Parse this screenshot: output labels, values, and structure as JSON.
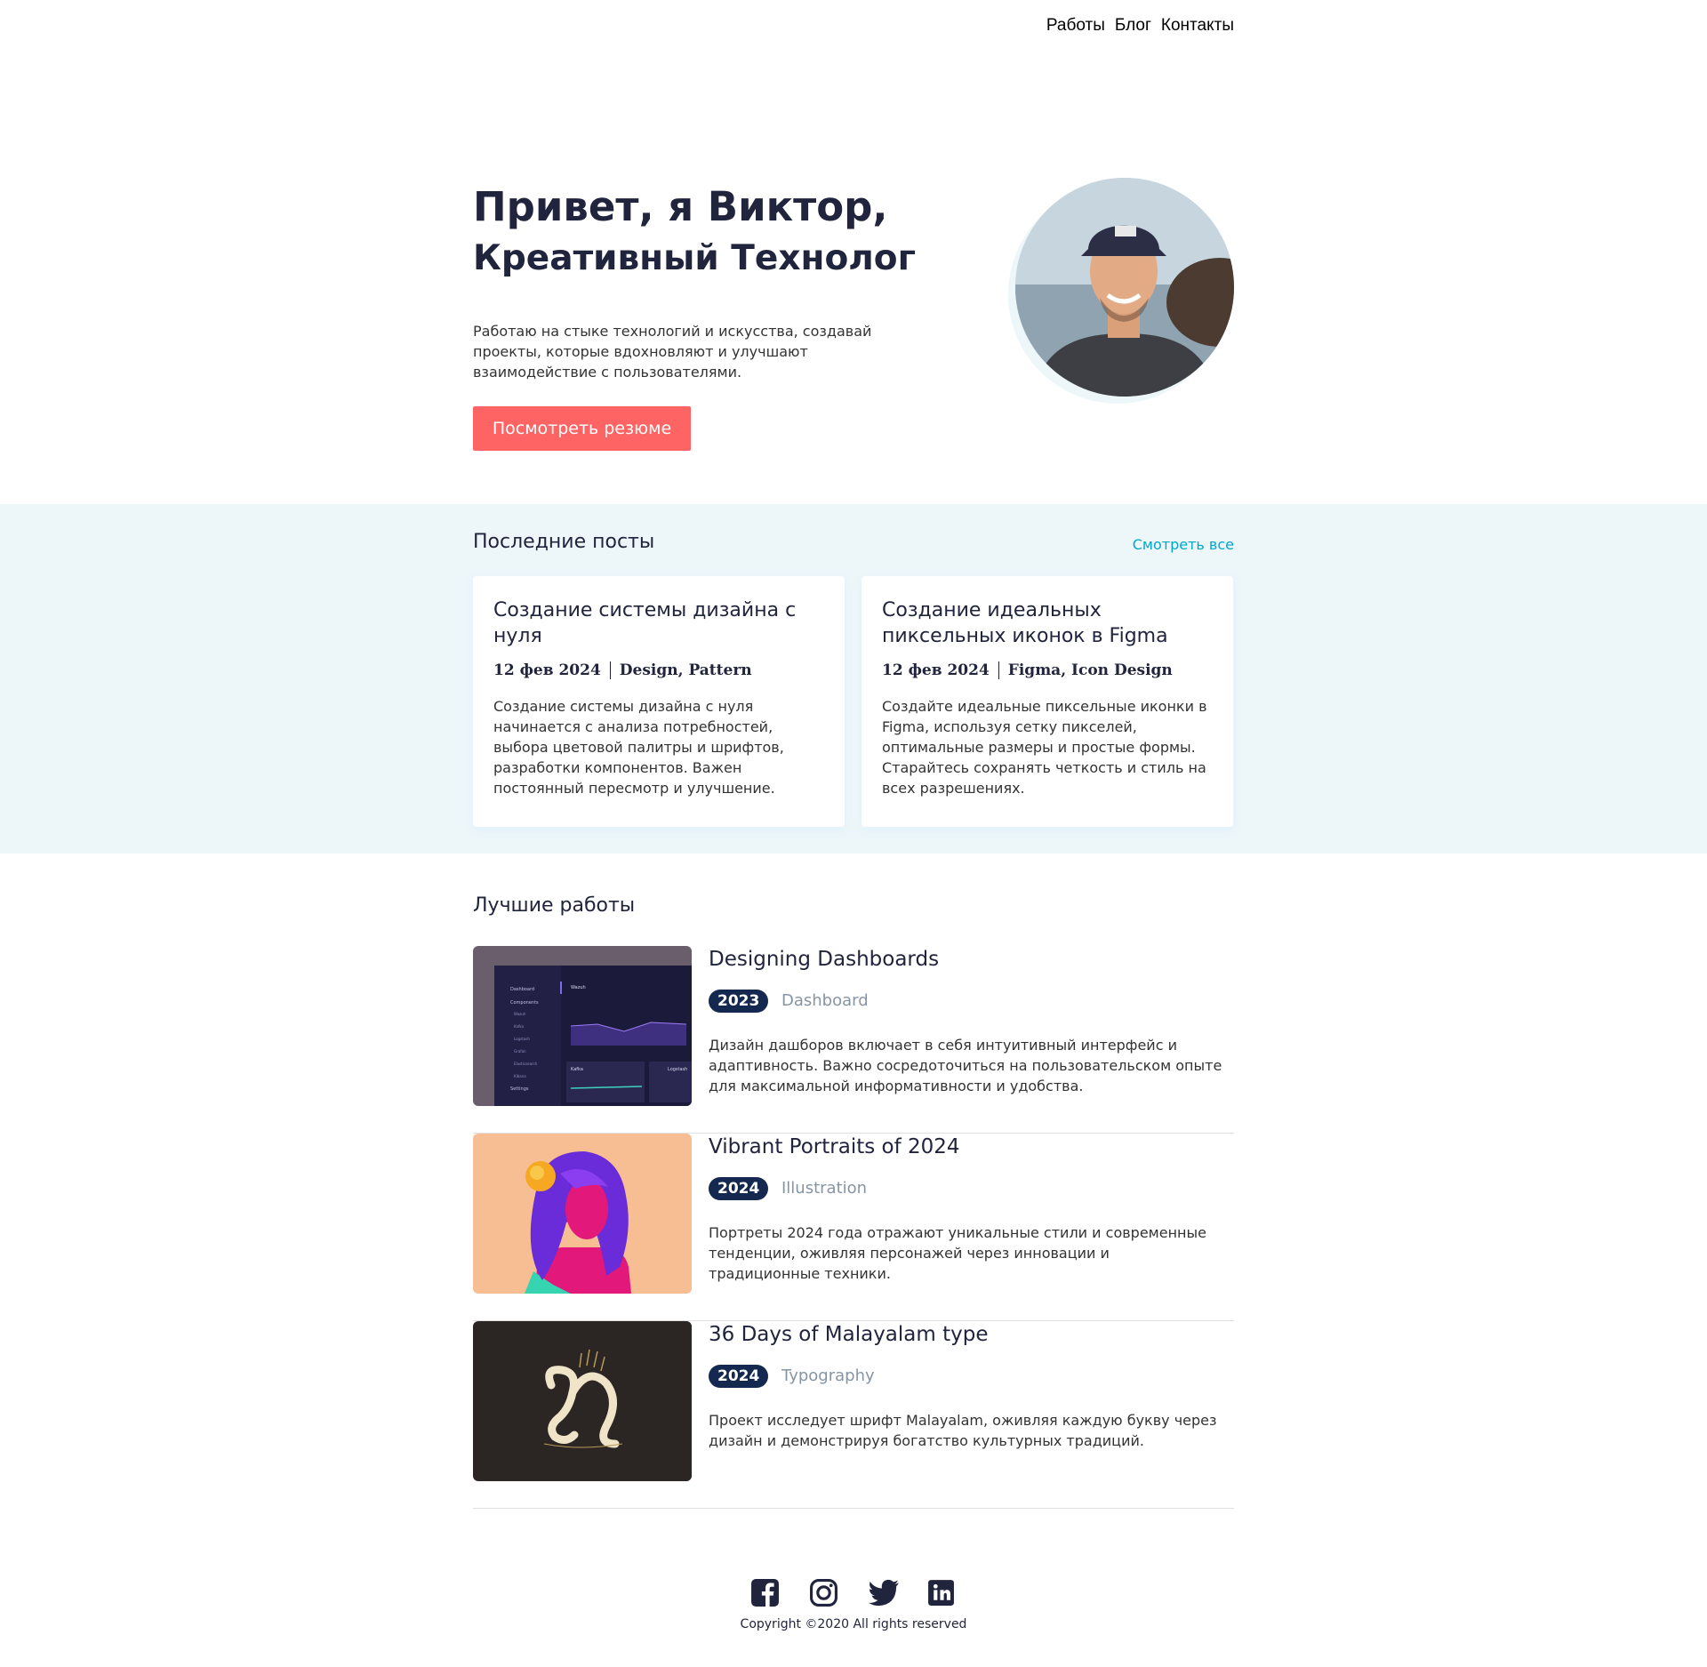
{
  "nav": {
    "items": [
      "Работы",
      "Блог",
      "Контакты"
    ]
  },
  "hero": {
    "title_line1": "Привет, я Виктор,",
    "title_line2": "Креативный Технолог",
    "description": "Работаю на стыке технологий и искусства, создавай проекты, которые вдохновляют и улучшают взаимодействие с пользователями.",
    "button_label": "Посмотреть резюме"
  },
  "posts": {
    "title": "Последние посты",
    "see_all": "Смотреть все",
    "items": [
      {
        "title": "Создание системы дизайна с нуля",
        "date": "12 фев 2024",
        "tags": "Design, Pattern",
        "excerpt": "Создание системы дизайна с нуля начинается с анализа потребностей, выбора цветовой палитры и шрифтов, разработки компонентов. Важен постоянный пересмотр и улучшение."
      },
      {
        "title": "Создание идеальных пиксельных иконок в Figma",
        "date": "12 фев 2024",
        "tags": "Figma, Icon Design",
        "excerpt": "Создайте идеальные пиксельные иконки в Figma, используя сетку пикселей, оптимальные размеры и простые формы. Старайтесь сохранять четкость и стиль на всех разрешениях."
      }
    ]
  },
  "works": {
    "title": "Лучшие работы",
    "items": [
      {
        "title": "Designing Dashboards",
        "year": "2023",
        "category": "Dashboard",
        "description": "Дизайн дашборов включает в себя интуитивный интерфейс и адаптивность. Важно сосредоточиться на пользовательском опыте для максимальной информативности и удобства.",
        "thumb_text": {
          "menu": [
            "Dashboard",
            "Components",
            "Wazuh",
            "Kafka",
            "Logstash",
            "Grafan",
            "Elasticsearch",
            "Kibana",
            "Settings"
          ],
          "panel_title": "Wazuh",
          "panel_kafka": "Kafka",
          "panel_logstash": "Logstash"
        }
      },
      {
        "title": "Vibrant Portraits of 2024",
        "year": "2024",
        "category": "Illustration",
        "description": "Портреты 2024 года отражают уникальные стили и современные тенденции, оживляя персонажей через инновации и традиционные техники."
      },
      {
        "title": "36 Days of Malayalam type",
        "year": "2024",
        "category": "Typography",
        "description": "Проект исследует шрифт Malayalam, оживляя каждую букву через дизайн и демонстрируя богатство культурных традиций."
      }
    ]
  },
  "footer": {
    "social": [
      "facebook-icon",
      "instagram-icon",
      "twitter-icon",
      "linkedin-icon"
    ],
    "copyright": "Copyright ©2020 All rights reserved"
  },
  "colors": {
    "accent": "#ff6464",
    "navy": "#21243d",
    "badge": "#142850",
    "posts_bg": "#edf7fa",
    "link": "#00a8cc"
  }
}
